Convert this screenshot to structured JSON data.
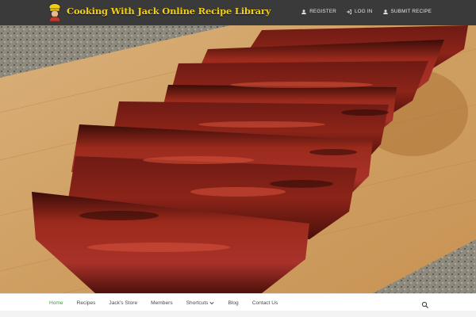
{
  "header": {
    "site_title": "Cooking With Jack Online Recipe Library",
    "logo_icon": "chef-icon",
    "links": [
      {
        "label": "REGISTER",
        "icon": "user-icon"
      },
      {
        "label": "LOG IN",
        "icon": "login-icon"
      },
      {
        "label": "SUBMIT RECIPE",
        "icon": "user-icon"
      }
    ]
  },
  "hero": {
    "image_subject": "bbq-ribs-photo"
  },
  "nav": {
    "items": [
      {
        "label": "Home",
        "active": true
      },
      {
        "label": "Recipes"
      },
      {
        "label": "Jack's Store"
      },
      {
        "label": "Members"
      },
      {
        "label": "Shortcuts",
        "dropdown": true
      },
      {
        "label": "Blog"
      },
      {
        "label": "Contact Us"
      }
    ],
    "search_icon": "search-icon"
  },
  "colors": {
    "topbar": "#3a3a3a",
    "title": "#f2cf16",
    "nav_active": "#3c9b3c",
    "nav_text": "#4a4a4a"
  }
}
